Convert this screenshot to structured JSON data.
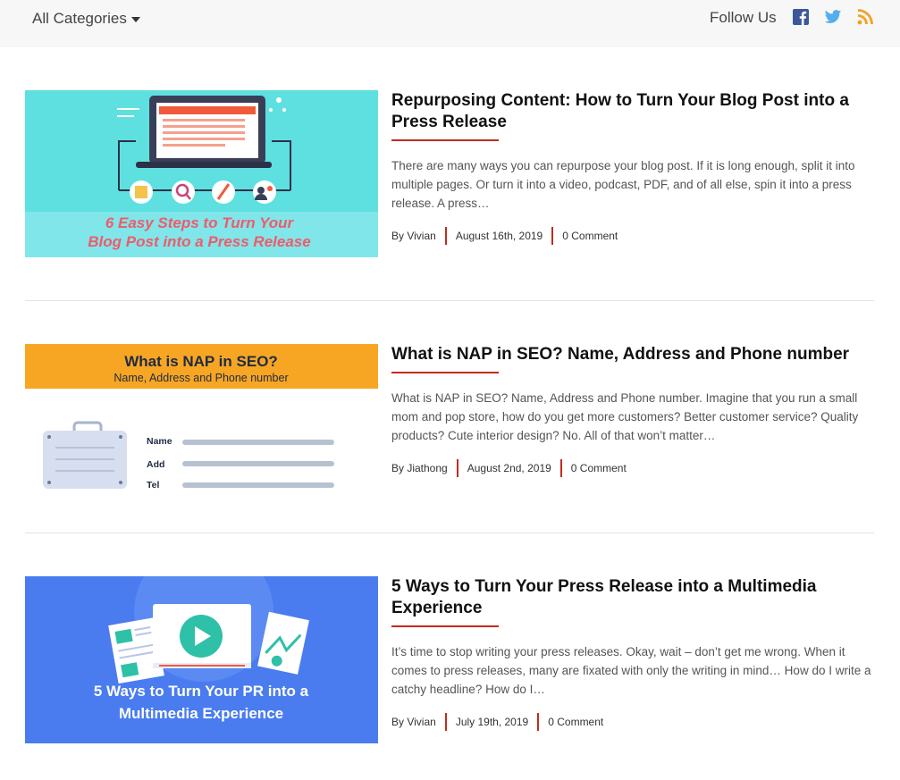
{
  "header": {
    "category_label": "All Categories",
    "follow_label": "Follow Us",
    "social_icons": [
      "facebook-icon",
      "twitter-icon",
      "rss-icon"
    ],
    "colors": {
      "facebook": "#3b5998",
      "twitter": "#55acee",
      "rss": "#f4a124"
    }
  },
  "accent_color": "#c22b1f",
  "posts": [
    {
      "title": "Repurposing Content: How to Turn Your Blog Post into a Press Release",
      "excerpt": "There are many ways you can repurpose your blog post. If it is long enough, split it into multiple pages. Or turn it into a video, podcast, PDF, and of all else, spin it into a press release. A press…",
      "author": "By Vivian",
      "date": "August 16th, 2019",
      "comments": "0 Comment",
      "image": {
        "line1": "6 Easy Steps to Turn Your",
        "line2": "Blog Post into a Press Release",
        "bg": "#5fe0e0"
      }
    },
    {
      "title": "What is NAP in SEO? Name, Address and Phone number",
      "excerpt": "What is NAP in SEO? Name, Address and Phone number. Imagine that you run a small mom and pop store, how do you get more customers? Better customer service? Quality products? Cute interior design? No. All of that won’t matter…",
      "author": "By Jiathong",
      "date": "August 2nd, 2019",
      "comments": "0 Comment",
      "image": {
        "heading": "What is NAP in SEO?",
        "subheading": "Name, Address and Phone number",
        "field1": "Name",
        "field2": "Add",
        "field3": "Tel",
        "bg": "#f7a623"
      }
    },
    {
      "title": "5 Ways to Turn Your Press Release into a Multimedia Experience",
      "excerpt": "It’s time to stop writing your press releases. Okay, wait – don’t get me wrong. When it comes to press releases, many are fixated with only the writing in mind… How do I write a catchy headline? How do I…",
      "author": "By Vivian",
      "date": "July 19th, 2019",
      "comments": "0 Comment",
      "image": {
        "line1": "5 Ways to Turn Your PR into a",
        "line2": "Multimedia Experience",
        "bg": "#4a7cf0"
      }
    }
  ]
}
